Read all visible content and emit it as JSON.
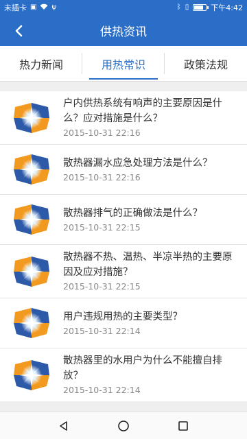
{
  "status": {
    "carrier": "未插卡",
    "time": "下午4:42",
    "battery_level": 0.85
  },
  "header": {
    "title": "供热资讯"
  },
  "tabs": [
    {
      "label": "热力新闻",
      "active": false
    },
    {
      "label": "用热常识",
      "active": true
    },
    {
      "label": "政策法规",
      "active": false
    }
  ],
  "articles": [
    {
      "title": "户内供热系统有响声的主要原因是什么？应对措施是什么？",
      "date": "2015-10-31 22:16"
    },
    {
      "title": "散热器漏水应急处理方法是什么？",
      "date": "2015-10-31 22:16"
    },
    {
      "title": "散热器排气的正确做法是什么？",
      "date": "2015-10-31 22:15"
    },
    {
      "title": "散热器不热、温热、半凉半热的主要原因及应对措施？",
      "date": "2015-10-31 22:15"
    },
    {
      "title": "用户违规用热的主要类型？",
      "date": "2015-10-31 22:14"
    },
    {
      "title": "散热器里的水用户为什么不能擅自排放？",
      "date": "2015-10-31 22:14"
    }
  ],
  "colors": {
    "primary": "#2a6ec8",
    "logo_blue": "#2c5aa8",
    "logo_orange": "#f29a1f"
  }
}
